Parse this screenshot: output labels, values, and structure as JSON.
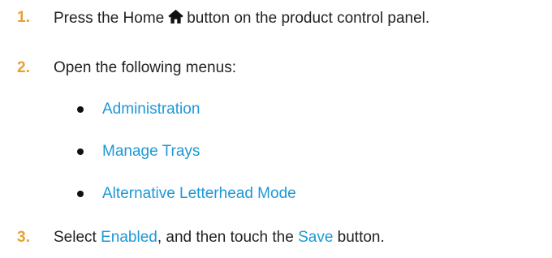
{
  "steps": [
    {
      "number": "1.",
      "text_before": "Press the Home",
      "icon": "home-icon",
      "text_after": "button on the product control panel."
    },
    {
      "number": "2.",
      "text": "Open the following menus:",
      "menus": [
        "Administration",
        "Manage Trays",
        "Alternative Letterhead Mode"
      ]
    },
    {
      "number": "3.",
      "text_1": "Select",
      "link_1": "Enabled",
      "text_2": ", and then touch the",
      "link_2": "Save",
      "text_3": "button."
    }
  ],
  "colors": {
    "step_number": "#e8a033",
    "link": "#1e98d6",
    "body_text": "#222222"
  }
}
